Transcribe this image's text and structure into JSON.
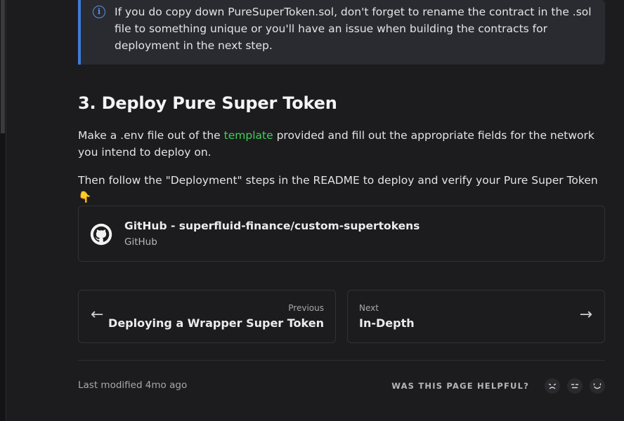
{
  "callout": {
    "icon": "info-icon",
    "text": "If you do copy down PureSuperToken.sol, don't forget to rename the contract in the .sol file to something unique or you'll have an issue when building the contracts for deployment in the next step."
  },
  "section": {
    "title": "3. Deploy Pure Super Token",
    "para1_before": "Make a .env file out of the ",
    "para1_link": "template",
    "para1_after": " provided and fill out the appropriate fields for the network you intend to deploy on.",
    "para2": "Then follow the \"Deployment\" steps in the README to deploy and verify your Pure Super Token 👇"
  },
  "link_card": {
    "icon": "github-icon",
    "title": "GitHub - superfluid-finance/custom-supertokens",
    "subtitle": "GitHub"
  },
  "pagination": {
    "prev_label": "Previous",
    "prev_title": "Deploying a Wrapper Super Token",
    "next_label": "Next",
    "next_title": "In-Depth"
  },
  "footer": {
    "last_modified": "Last modified 4mo ago",
    "helpful_label": "WAS THIS PAGE HELPFUL?",
    "faces": [
      "sad-face-icon",
      "neutral-face-icon",
      "happy-face-icon"
    ]
  },
  "colors": {
    "background": "#1c1c1e",
    "callout_accent": "#3e7bd8",
    "link": "#3fcf5a"
  }
}
